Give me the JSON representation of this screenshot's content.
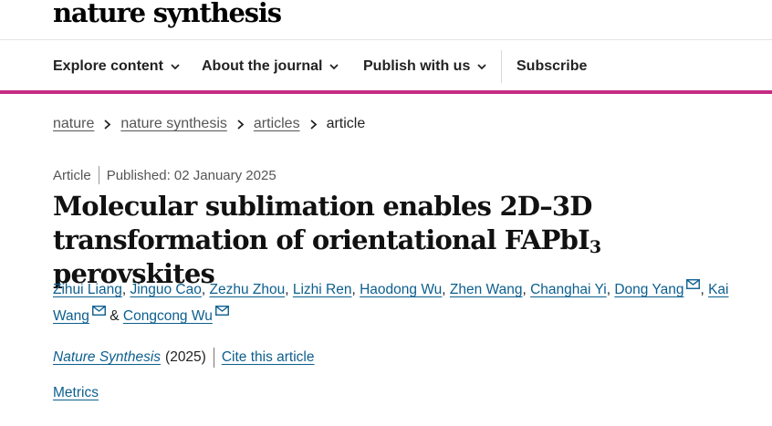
{
  "header": {
    "logo": "nature synthesis"
  },
  "nav": {
    "explore_label": "Explore content",
    "about_label": "About the journal",
    "publish_label": "Publish with us",
    "subscribe_label": "Subscribe"
  },
  "breadcrumb": [
    "nature",
    "nature synthesis",
    "articles",
    "article"
  ],
  "article": {
    "type": "Article",
    "published": "Published: 02 January 2025",
    "title_part1": "Molecular sublimation enables 2D–3D transformation of orientational FAPbI",
    "title_sub": "3",
    "title_part2": " perovskites",
    "authors": [
      "Zihui Liang",
      "Jinguo Cao",
      "Zezhu Zhou",
      "Lizhi Ren",
      "Haodong Wu",
      "Zhen Wang",
      "Changhai Yi",
      "Dong Yang",
      "Kai Wang",
      "Congcong Wu"
    ],
    "separator": ",",
    "and_text": "&",
    "journal": "Nature Synthesis",
    "year": "(2025)",
    "cite_label": "Cite this article",
    "metrics_label": "Metrics"
  },
  "colors": {
    "accent": "#c42c83",
    "link": "#0c5f8f",
    "text": "#222222"
  }
}
